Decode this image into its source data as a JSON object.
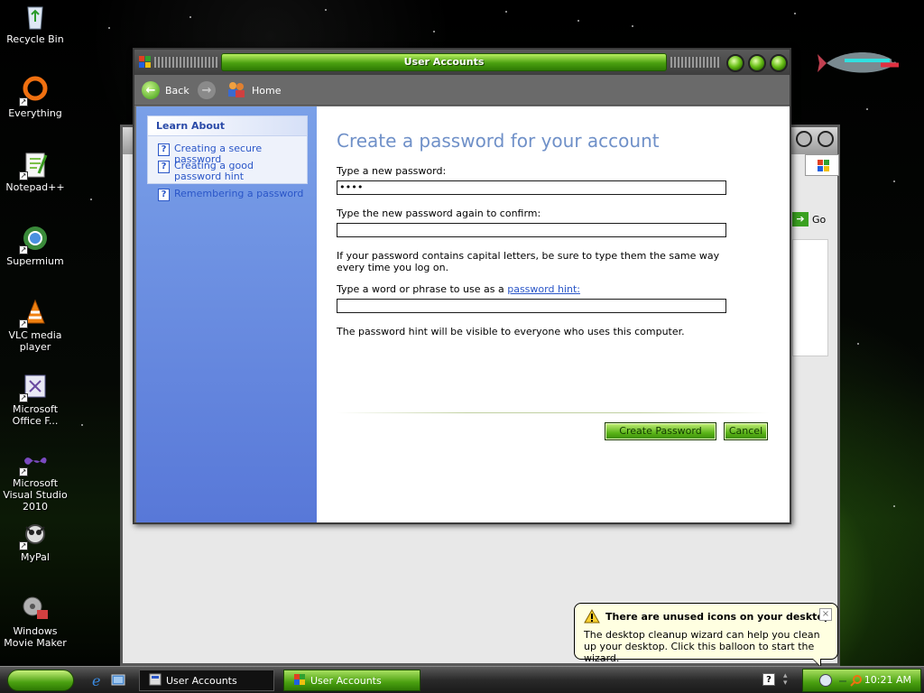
{
  "desktop": {
    "icons": [
      {
        "label": "Recycle Bin"
      },
      {
        "label": "Everything"
      },
      {
        "label": "Notepad++"
      },
      {
        "label": "Supermium"
      },
      {
        "label": "VLC media player"
      },
      {
        "label": "Microsoft Office F..."
      },
      {
        "label": "Microsoft Visual Studio 2010"
      },
      {
        "label": "MyPal"
      },
      {
        "label": "Windows Movie Maker"
      }
    ]
  },
  "back_window": {
    "go_label": "Go"
  },
  "window": {
    "title": "User Accounts",
    "toolbar": {
      "back_label": "Back",
      "home_label": "Home"
    },
    "sidebar": {
      "heading": "Learn About",
      "items": [
        {
          "label": "Creating a secure password"
        },
        {
          "label": "Creating a good password hint"
        },
        {
          "label": "Remembering a password"
        }
      ]
    },
    "form": {
      "heading": "Create a password for your account",
      "new_password_label": "Type a new password:",
      "new_password_value": "••••",
      "confirm_label": "Type the new password again to confirm:",
      "confirm_value": "",
      "caps_note": "If your password contains capital letters, be sure to type them the same way every time you log on.",
      "hint_label_prefix": "Type a word or phrase to use as a",
      "hint_link": "password hint:",
      "hint_value": "",
      "hint_note": "The password hint will be visible to everyone who uses this computer.",
      "create_button": "Create Password",
      "cancel_button": "Cancel"
    }
  },
  "balloon": {
    "title": "There are unused icons on your desktop",
    "text": "The desktop cleanup wizard can help you clean up your desktop. Click this balloon to start the wizard.",
    "close": "×"
  },
  "taskbar": {
    "tasks": [
      {
        "label": "User Accounts",
        "active": false
      },
      {
        "label": "User Accounts",
        "active": true
      }
    ],
    "clock": "10:21 AM",
    "help_glyph": "?"
  },
  "colors": {
    "accent_green": "#4aa010",
    "heading_blue": "#6f90c8",
    "link_blue": "#2a56c8",
    "sidebar_blue": "#5878d8",
    "balloon_bg": "#ffffe1"
  }
}
